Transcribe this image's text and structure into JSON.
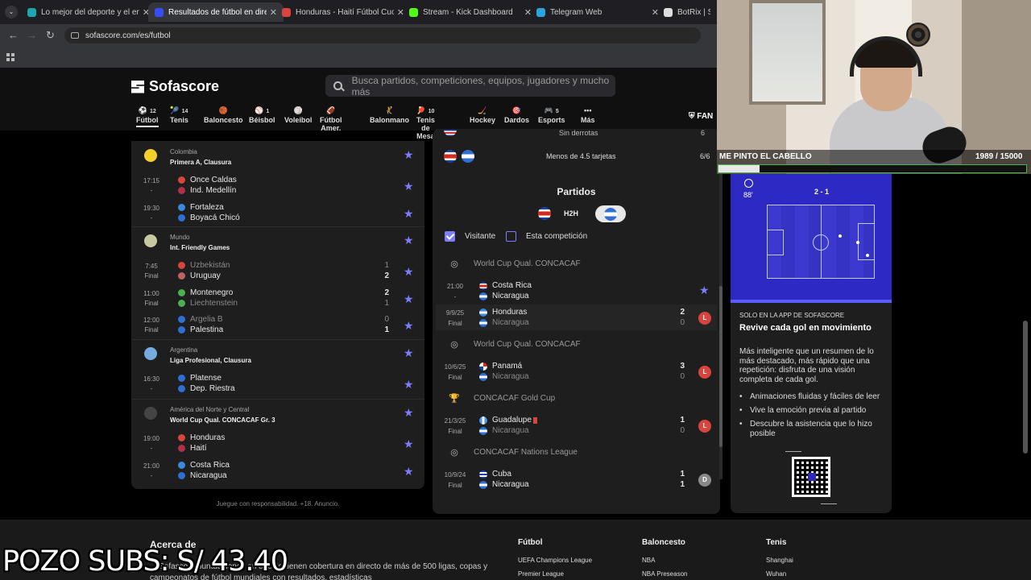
{
  "browser": {
    "tabs": [
      {
        "label": "Lo mejor del deporte y el entre",
        "color": "#20a4b0"
      },
      {
        "label": "Resultados de fútbol en directo",
        "color": "#374df5"
      },
      {
        "label": "Honduras - Haití Fútbol Cuotas",
        "color": "#d8453e"
      },
      {
        "label": "Stream - Kick Dashboard",
        "color": "#53fc18"
      },
      {
        "label": "Telegram Web",
        "color": "#2aa3e0"
      },
      {
        "label": "BotRix | Sorte",
        "color": "#dddddd"
      }
    ],
    "active_tab": 1,
    "url": "sofascore.com/es/futbol"
  },
  "header": {
    "logo": "Sofascore",
    "search_placeholder": "Busca partidos, competiciones, equipos, jugadores y mucho más",
    "sports": [
      {
        "label": "Fútbol",
        "count": "12",
        "icon": "football-icon",
        "glyph": "⚽"
      },
      {
        "label": "Tenis",
        "count": "14",
        "icon": "tennis-icon",
        "glyph": "🎾"
      },
      {
        "label": "Baloncesto",
        "count": "",
        "icon": "basketball-icon",
        "glyph": "🏀"
      },
      {
        "label": "Béisbol",
        "count": "1",
        "icon": "baseball-icon",
        "glyph": "⚾"
      },
      {
        "label": "Voleibol",
        "count": "",
        "icon": "volleyball-icon",
        "glyph": "🏐"
      },
      {
        "label": "Fútbol Amer.",
        "count": "",
        "icon": "american-football-icon",
        "glyph": "🏈"
      },
      {
        "label": "Balonmano",
        "count": "",
        "icon": "handball-icon",
        "glyph": "🤾"
      },
      {
        "label": "Tenis de Mesa",
        "count": "10",
        "icon": "table-tennis-icon",
        "glyph": "🏓"
      },
      {
        "label": "Hockey",
        "count": "",
        "icon": "hockey-icon",
        "glyph": "🏒"
      },
      {
        "label": "Dardos",
        "count": "",
        "icon": "darts-icon",
        "glyph": "🎯"
      },
      {
        "label": "Esports",
        "count": "5",
        "icon": "esports-icon",
        "glyph": "🎮"
      },
      {
        "label": "Más",
        "count": "",
        "icon": "more-icon",
        "glyph": "•••"
      }
    ],
    "fan_label": "FAN"
  },
  "left": {
    "leagues": [
      {
        "country": "Colombia",
        "name": "Primera A, Clausura",
        "flag": "#f5d02a",
        "matches": [
          {
            "time": "17:15",
            "status": "-",
            "home": "Once Caldas",
            "away": "Ind. Medellín",
            "hs": "",
            "as": ""
          },
          {
            "time": "19:30",
            "status": "-",
            "home": "Fortaleza",
            "away": "Boyacá Chicó",
            "hs": "",
            "as": ""
          }
        ]
      },
      {
        "country": "Mundo",
        "name": "Int. Friendly Games",
        "flag": "#c8c8a0",
        "matches": [
          {
            "time": "7:45",
            "status": "Final",
            "home": "Uzbekistán",
            "away": "Uruguay",
            "hs": "1",
            "as": "2"
          },
          {
            "time": "11:00",
            "status": "Final",
            "home": "Montenegro",
            "away": "Liechtenstein",
            "hs": "2",
            "as": "1"
          },
          {
            "time": "12:00",
            "status": "Final",
            "home": "Argelia B",
            "away": "Palestina",
            "hs": "0",
            "as": "1"
          }
        ]
      },
      {
        "country": "Argentina",
        "name": "Liga Profesional, Clausura",
        "flag": "#74acdf",
        "matches": [
          {
            "time": "16:30",
            "status": "-",
            "home": "Platense",
            "away": "Dep. Riestra",
            "hs": "",
            "as": ""
          }
        ]
      },
      {
        "country": "América del Norte y Central",
        "name": "World Cup Qual. CONCACAF Gr. 3",
        "flag": "#444444",
        "matches": [
          {
            "time": "19:00",
            "status": "-",
            "home": "Honduras",
            "away": "Haití",
            "hs": "",
            "as": ""
          },
          {
            "time": "21:00",
            "status": "-",
            "home": "Costa Rica",
            "away": "Nicaragua",
            "hs": "",
            "as": ""
          }
        ]
      }
    ],
    "responsible": "Juegue con responsabilidad. +18. Anuncio."
  },
  "middle": {
    "top_stat_label": "Sin derrotas",
    "top_stat_value": "6",
    "cards_stat_label": "Menos de 4.5 tarjetas",
    "cards_stat_value": "6/6",
    "partidos_title": "Partidos",
    "h2h_label": "H2H",
    "filter_visitante": "Visitante",
    "filter_competicion": "Esta competición",
    "groups": [
      {
        "competition": "World Cup Qual. CONCACAF",
        "matches": [
          {
            "date": "21:00",
            "status": "-",
            "home": "Costa Rica",
            "away": "Nicaragua",
            "hs": "",
            "as": "",
            "result": "",
            "home_flag": "cr",
            "away_flag": "ni",
            "starred": true
          },
          {
            "date": "9/9/25",
            "status": "Final",
            "home": "Honduras",
            "away": "Nicaragua",
            "hs": "2",
            "as": "0",
            "result": "L",
            "home_flag": "ho",
            "away_flag": "ni"
          }
        ]
      },
      {
        "competition": "World Cup Qual. CONCACAF",
        "matches": [
          {
            "date": "10/6/25",
            "status": "Final",
            "home": "Panamá",
            "away": "Nicaragua",
            "hs": "3",
            "as": "0",
            "result": "L",
            "home_flag": "pa",
            "away_flag": "ni"
          }
        ]
      },
      {
        "competition": "CONCACAF Gold Cup",
        "matches": [
          {
            "date": "21/3/25",
            "status": "Final",
            "home": "Guadalupe",
            "away": "Nicaragua",
            "hs": "1",
            "as": "0",
            "result": "L",
            "home_flag": "gu",
            "away_flag": "ni",
            "red_card": true
          }
        ]
      },
      {
        "competition": "CONCACAF Nations League",
        "matches": [
          {
            "date": "10/9/24",
            "status": "Final",
            "home": "Cuba",
            "away": "Nicaragua",
            "hs": "1",
            "as": "1",
            "result": "D",
            "home_flag": "cu",
            "away_flag": "ni"
          }
        ]
      }
    ]
  },
  "right": {
    "minute": "88'",
    "score": "2 - 1",
    "promo_tag": "SOLO EN LA APP DE SOFASCORE",
    "promo_title": "Revive cada gol en movimiento",
    "promo_desc": "Más inteligente que un resumen de lo más destacado, más rápido que una repetición: disfruta de una visión completa de cada gol.",
    "bullets": [
      "Animaciones fluidas y fáciles de leer",
      "Vive la emoción previa al partido",
      "Descubre la asistencia que lo hizo posible"
    ]
  },
  "footer": {
    "about_title": "Acerca de",
    "about_text": "... Sofascore puntuaciones en directo tienen cobertura en directo de más de 500 ligas, copas y campeonatos de fútbol mundiales con resultados, estadísticas",
    "columns": [
      {
        "title": "Fútbol",
        "items": [
          "UEFA Champions League",
          "Premier League"
        ]
      },
      {
        "title": "Baloncesto",
        "items": [
          "NBA",
          "NBA Preseason"
        ]
      },
      {
        "title": "Tenis",
        "items": [
          "Shanghai",
          "Wuhan"
        ]
      }
    ]
  },
  "overlay": {
    "pozo": "POZO SUBS: S/ 43.40",
    "sub_goal_title": "ME PINTO EL CABELLO",
    "sub_goal_count": "1989  / 15000",
    "sub_goal_progress": 0.1326
  }
}
